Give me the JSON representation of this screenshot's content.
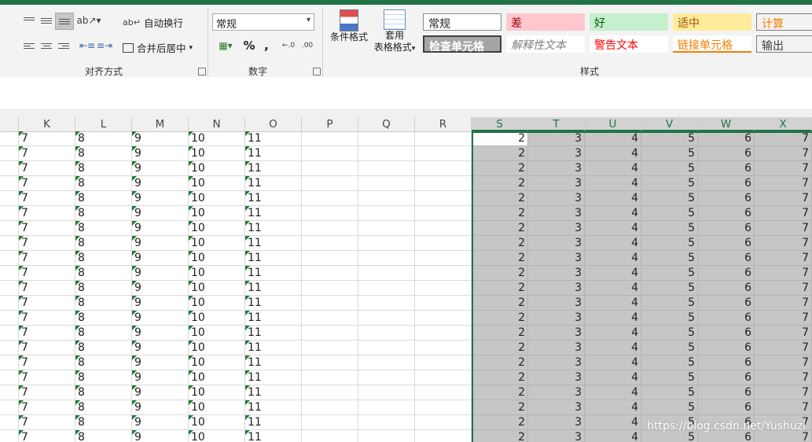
{
  "ribbon": {
    "alignment": {
      "wrap_text": "自动换行",
      "merge_center": "合并后居中",
      "group_label": "对齐方式"
    },
    "number": {
      "format_value": "常规",
      "percent": "%",
      "comma": ",",
      "group_label": "数字"
    },
    "styles": {
      "cond_format": "条件格式",
      "table_format_1": "套用",
      "table_format_2": "表格格式",
      "group_label": "样式",
      "cells": [
        {
          "label": "常规",
          "bg": "#ffffff",
          "color": "#222222"
        },
        {
          "label": "差",
          "bg": "#ffc7ce",
          "color": "#9c0006"
        },
        {
          "label": "好",
          "bg": "#c6efce",
          "color": "#006100"
        },
        {
          "label": "适中",
          "bg": "#ffeb9c",
          "color": "#9c5700"
        },
        {
          "label": "计算",
          "bg": "#f2f2f2",
          "color": "#fa7d00"
        },
        {
          "label": "检查单元格",
          "bg": "#a5a5a5",
          "color": "#ffffff"
        },
        {
          "label": "解释性文本",
          "bg": "#ffffff",
          "color": "#7f7f7f"
        },
        {
          "label": "警告文本",
          "bg": "#ffffff",
          "color": "#ff0000"
        },
        {
          "label": "链接单元格",
          "bg": "#ffffff",
          "color": "#fa7d00"
        },
        {
          "label": "输出",
          "bg": "#f2f2f2",
          "color": "#3f3f3f"
        }
      ]
    }
  },
  "columns": [
    "K",
    "L",
    "M",
    "N",
    "O",
    "P",
    "Q",
    "R",
    "S",
    "T",
    "U",
    "V",
    "W",
    "X"
  ],
  "text_values": [
    "7",
    "8",
    "9",
    "10",
    "11"
  ],
  "num_values": [
    "2",
    "3",
    "4",
    "5",
    "6",
    "7"
  ],
  "row_count": 21,
  "watermark": "https://blog.csdn.net/Yushuzi"
}
